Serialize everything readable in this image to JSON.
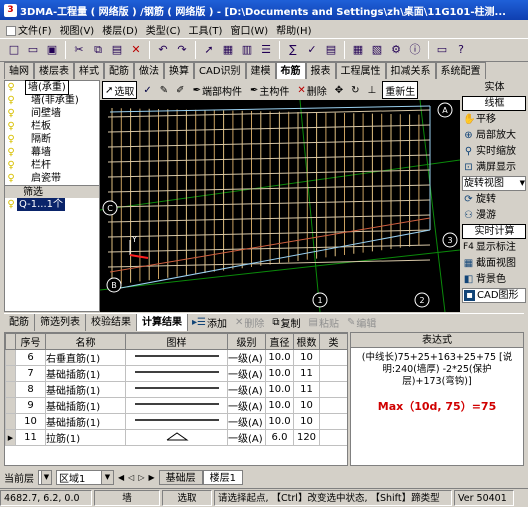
{
  "window": {
    "title": "3DMA-工程量 ( 网络版 ) /钢筋 ( 网络版 ) - [D:\\Documents and Settings\\zh\\桌面\\11G101-柱测..."
  },
  "menu": [
    "文件(F)",
    "视图(V)",
    "楼层(D)",
    "类型(C)",
    "工具(T)",
    "窗口(W)",
    "帮助(H)"
  ],
  "module_tabs": [
    "轴网",
    "楼层表",
    "样式",
    "配筋",
    "做法",
    "换算",
    "CAD识别",
    "建模",
    "布筋",
    "报表",
    "工程属性",
    "扣减关系",
    "系统配置"
  ],
  "active_module_tab": "布筋",
  "component_list": {
    "items": [
      "墙(承重)",
      "墙(非承重)",
      "间壁墙",
      "栏板",
      "隔断",
      "幕墙",
      "栏杆",
      "启瓷带"
    ],
    "filter_label": "筛选",
    "filtered": [
      "Q-1...1个"
    ]
  },
  "canvas_toolbar": {
    "select": "选取",
    "end_component": "端部构件",
    "main_component": "主构件",
    "delete": "删除",
    "regenerate": "重新生"
  },
  "canvas": {
    "axis_labels": [
      "C",
      "B",
      "1",
      "2",
      "3",
      "A"
    ],
    "ucs": "Y"
  },
  "right_panel": {
    "solid": "实体",
    "wireframe": "线框",
    "pan": "平移",
    "local_zoom": "局部放大",
    "realtime_zoom": "实时缩放",
    "fit": "满屏显示",
    "rotate_view": "旋转视图",
    "rotate": "旋转",
    "roam": "漫游",
    "realtime_calc": "实时计算",
    "f4_label": "F4",
    "show_label": "显示标注",
    "section_view": "截面视图",
    "bg_color": "背景色",
    "cad_graphic": "CAD图形"
  },
  "bottom_tabs": [
    "配筋",
    "筛选列表",
    "校验结果",
    "计算结果"
  ],
  "active_bottom_tab": "计算结果",
  "bottom_tools": {
    "add": "添加",
    "delete": "删除",
    "copy": "复制",
    "paste": "粘贴",
    "edit": "编辑"
  },
  "grid": {
    "headers": [
      "序号",
      "名称",
      "图样",
      "级别",
      "直径",
      "根数",
      "类"
    ],
    "rows": [
      {
        "seq": "6",
        "name": "右垂直筋(1)",
        "grade": "一级(A)",
        "dia": "10.0",
        "count": "10"
      },
      {
        "seq": "7",
        "name": "基础插筋(1)",
        "grade": "一级(A)",
        "dia": "10.0",
        "count": "11"
      },
      {
        "seq": "8",
        "name": "基础插筋(1)",
        "grade": "一级(A)",
        "dia": "10.0",
        "count": "11"
      },
      {
        "seq": "9",
        "name": "基础插筋(1)",
        "grade": "一级(A)",
        "dia": "10.0",
        "count": "10"
      },
      {
        "seq": "10",
        "name": "基础插筋(1)",
        "grade": "一级(A)",
        "dia": "10.0",
        "count": "10"
      },
      {
        "seq": "11",
        "name": "拉筋(1)",
        "grade": "一级(A)",
        "dia": "6.0",
        "count": "120"
      }
    ],
    "current_row": 5
  },
  "expression": {
    "header": "表达式",
    "text": "(中线长)75+25+163+25+75 [说明:240(墙厚) -2*25(保护层)+173(弯钩)]",
    "max": "Max（10d, 75）=75"
  },
  "layer_bar": {
    "current_layer_label": "当前层",
    "area_value": "区域1",
    "tabs": [
      "基础层",
      "楼层1"
    ],
    "active_tab": "楼层1"
  },
  "status": {
    "coords": "4682.7, 6.2, 0.0",
    "component": "墙",
    "mode": "选取",
    "hint": "请选择起点, 【Ctrl】改变选中状态, 【Shift】蹄类型",
    "version": "Ver 50401"
  }
}
